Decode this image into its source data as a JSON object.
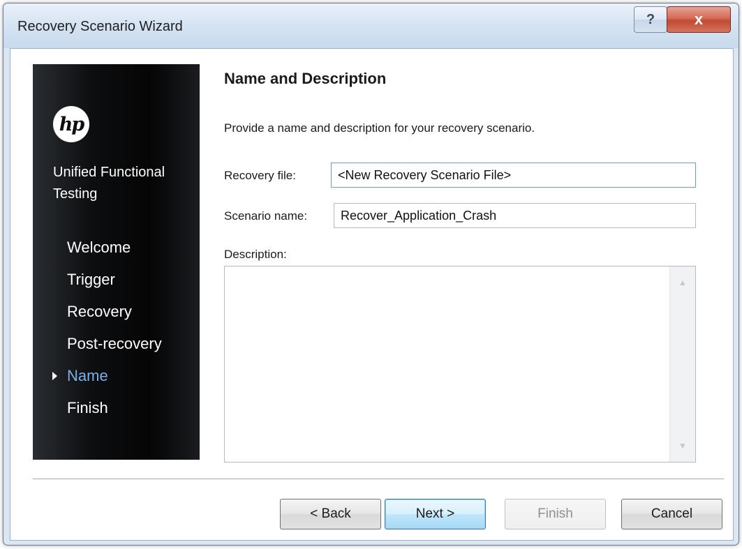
{
  "window": {
    "title": "Recovery Scenario Wizard",
    "help_glyph": "?",
    "close_glyph": "x"
  },
  "sidebar": {
    "logo_text": "hp",
    "product_name": "Unified Functional Testing",
    "steps": [
      {
        "label": "Welcome",
        "active": false
      },
      {
        "label": "Trigger",
        "active": false
      },
      {
        "label": "Recovery",
        "active": false
      },
      {
        "label": "Post-recovery",
        "active": false
      },
      {
        "label": "Name",
        "active": true
      },
      {
        "label": "Finish",
        "active": false
      }
    ]
  },
  "main": {
    "heading": "Name and Description",
    "intro": "Provide a name and description for your recovery scenario.",
    "recovery_file_label": "Recovery file:",
    "recovery_file_value": "<New Recovery Scenario File>",
    "scenario_name_label": "Scenario name:",
    "scenario_name_value": "Recover_Application_Crash",
    "description_label": "Description:",
    "description_value": ""
  },
  "buttons": {
    "back": "< Back",
    "next": "Next >",
    "finish": "Finish",
    "cancel": "Cancel"
  },
  "colors": {
    "active_step": "#7ab0e8",
    "sidebar_bg": "#0d0e10",
    "close_button": "#c24a33"
  }
}
